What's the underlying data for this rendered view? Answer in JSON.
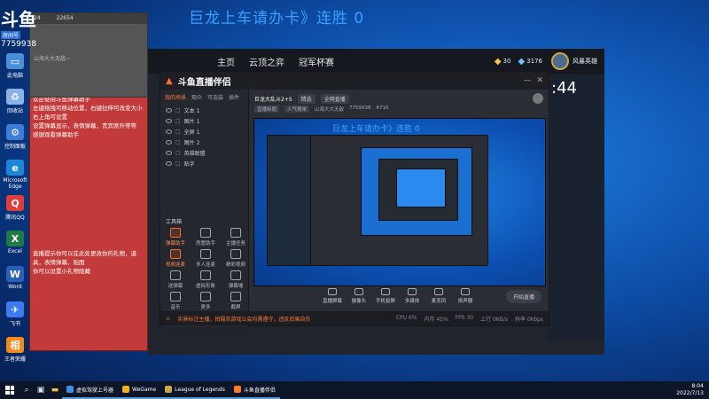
{
  "overlay": {
    "title": "巨龙上车请办卡》连胜 0"
  },
  "badge": {
    "logo": "斗鱼",
    "tag": "房间号",
    "room": "7759938"
  },
  "mini_window": {
    "tabs": [
      "24",
      "22654"
    ],
    "hint": "山海大大无敌~"
  },
  "desktop_icons": [
    {
      "label": "此电脑",
      "color": "#4a90d9",
      "glyph": "▭"
    },
    {
      "label": "回收站",
      "color": "#8ab4e8",
      "glyph": "♻"
    },
    {
      "label": "控制面板",
      "color": "#3b7dd8",
      "glyph": "⚙"
    },
    {
      "label": "Microsoft Edge",
      "color": "#1b87d6",
      "glyph": "e"
    },
    {
      "label": "腾讯QQ",
      "color": "#e03c3c",
      "glyph": "Q"
    },
    {
      "label": "Excel",
      "color": "#1f7a45",
      "glyph": "X"
    },
    {
      "label": "Word",
      "color": "#2b5fb8",
      "glyph": "W"
    },
    {
      "label": "飞书",
      "color": "#3d7bf0",
      "glyph": "✈"
    },
    {
      "label": "王者荣耀",
      "color": "#f08a1e",
      "glyph": "相"
    }
  ],
  "chat": {
    "lines": [
      "欢迎使用斗鱼弹幕助手",
      "左键拖拽可移动位置，右键拉伸可改变大小",
      "右上角可设置",
      "设置弹幕显示，表情弹幕，贵宾席升等等",
      "感谢观看弹幕助手"
    ],
    "lines2": [
      "直播提示你可以在此处更改你的礼物，道具，表情弹幕，贴图",
      "你可以设置小礼物隐藏"
    ]
  },
  "client": {
    "nav": [
      "主页",
      "云顶之弈",
      "冠军杯赛"
    ],
    "stats": [
      "30",
      "3176"
    ],
    "user": "风暴英雄",
    "time": ":44"
  },
  "helper": {
    "brand": "斗鱼直播伴侣",
    "tabs": [
      "我的场景",
      "观众",
      "可选装",
      "插件"
    ],
    "scenes": [
      "文本 1",
      "图片 1",
      "全屏 1",
      "图片 2",
      "英雄联盟",
      "贴字"
    ],
    "tools_title": "工具箱",
    "tools": [
      {
        "label": "弹幕助手",
        "hot": true
      },
      {
        "label": "房管助手",
        "hot": false
      },
      {
        "label": "主播任务",
        "hot": false
      },
      {
        "label": "视频连麦",
        "hot": true
      },
      {
        "label": "多人连麦",
        "hot": false
      },
      {
        "label": "精彩视频",
        "hot": false
      },
      {
        "label": "送弹幕",
        "hot": false
      },
      {
        "label": "虚拟形象",
        "hot": false
      },
      {
        "label": "弹幕墙",
        "hot": false
      },
      {
        "label": "音乐",
        "hot": false
      },
      {
        "label": "更多",
        "hot": false
      },
      {
        "label": "截屏",
        "hot": false
      }
    ],
    "stage": {
      "title": "巨龙大乱斗2+5",
      "chip1": "精选",
      "chip2": "全网直播",
      "chip3": "直播标题",
      "chip4": "人气榜单",
      "user": "山海大大无敌",
      "room": "7759938",
      "fans": "6716"
    },
    "preview_title": "巨龙上车请办卡》连胜 0",
    "controls": [
      "直播屏幕",
      "摄像头",
      "手机投屏",
      "多媒体",
      "麦克风",
      "扬声器"
    ],
    "go_live": "开始直播",
    "status": {
      "warn": "实景标注主播，拍摄及游戏公会均需遵守，违反后果自负",
      "items": [
        "CPU 6%",
        "内存 45%",
        "FPS 30",
        "上行 0KB/s",
        "码率 0kbps"
      ]
    }
  },
  "taskbar": {
    "apps": [
      {
        "label": "虚拟驾驶上号器",
        "color": "#3a8ee6"
      },
      {
        "label": "WeGame",
        "color": "#f2b01e"
      },
      {
        "label": "League of Legends",
        "color": "#c9a74a"
      },
      {
        "label": "斗鱼直播伴侣",
        "color": "#ff7a2a"
      }
    ],
    "time": "8:04",
    "date": "2022/7/13"
  }
}
